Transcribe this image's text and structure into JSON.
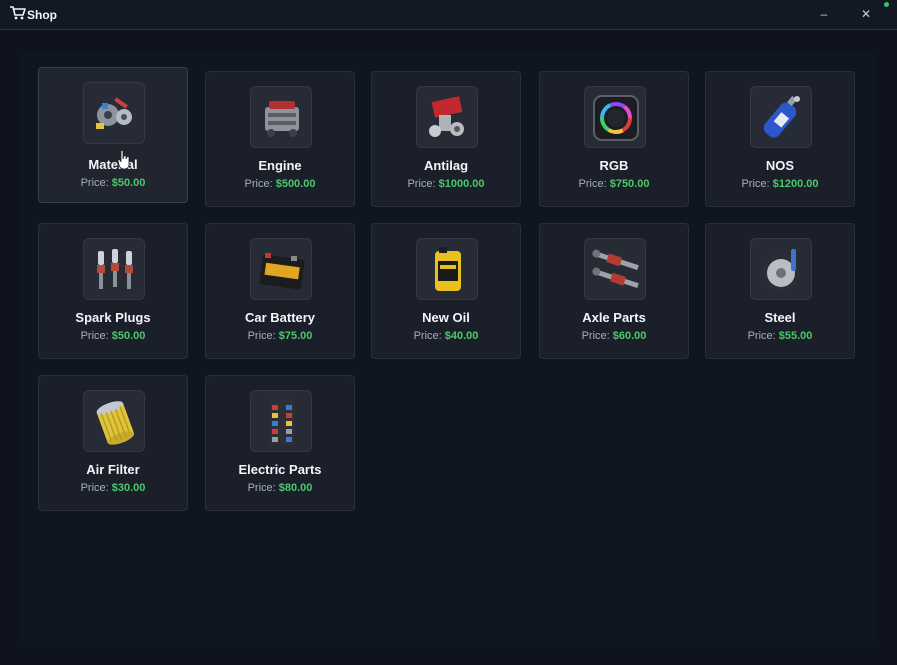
{
  "window": {
    "title": "Shop",
    "minimize_label": "–",
    "close_label": "✕",
    "accent_color": "#4cc86a"
  },
  "price_prefix": "Price:",
  "items": [
    {
      "name": "Material",
      "price": "$50.00",
      "icon": "material-icon"
    },
    {
      "name": "Engine",
      "price": "$500.00",
      "icon": "engine-icon"
    },
    {
      "name": "Antilag",
      "price": "$1000.00",
      "icon": "antilag-icon"
    },
    {
      "name": "RGB",
      "price": "$750.00",
      "icon": "rgb-icon"
    },
    {
      "name": "NOS",
      "price": "$1200.00",
      "icon": "nos-icon"
    },
    {
      "name": "Spark Plugs",
      "price": "$50.00",
      "icon": "spark-plugs-icon"
    },
    {
      "name": "Car Battery",
      "price": "$75.00",
      "icon": "car-battery-icon"
    },
    {
      "name": "New Oil",
      "price": "$40.00",
      "icon": "oil-icon"
    },
    {
      "name": "Axle Parts",
      "price": "$60.00",
      "icon": "axle-parts-icon"
    },
    {
      "name": "Steel",
      "price": "$55.00",
      "icon": "steel-icon"
    },
    {
      "name": "Air Filter",
      "price": "$30.00",
      "icon": "air-filter-icon"
    },
    {
      "name": "Electric Parts",
      "price": "$80.00",
      "icon": "electric-parts-icon"
    }
  ]
}
